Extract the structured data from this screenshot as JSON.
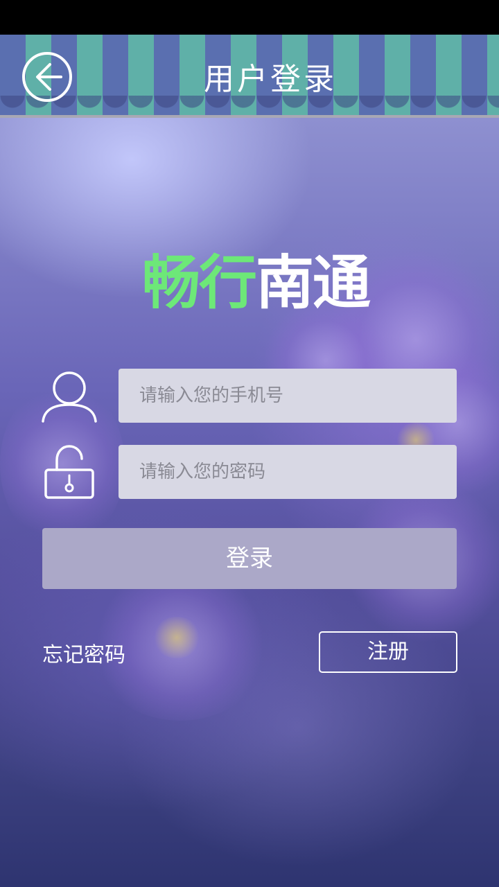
{
  "header": {
    "title": "用户登录",
    "back_icon": "arrow-left-circle-icon"
  },
  "logo": {
    "part1": "畅行",
    "part2": "南通",
    "part1_color": "#6de878",
    "part2_color": "#ffffff"
  },
  "form": {
    "phone_icon": "user-icon",
    "phone_placeholder": "请输入您的手机号",
    "password_icon": "lock-icon",
    "password_placeholder": "请输入您的密码",
    "login_label": "登录"
  },
  "links": {
    "forgot_password": "忘记密码",
    "register": "注册"
  },
  "colors": {
    "header_stripe_blue": "#5a6fb0",
    "header_stripe_teal": "#5fb0a8",
    "input_bg": "#d8d8e4",
    "button_bg": "#aba8c8"
  }
}
